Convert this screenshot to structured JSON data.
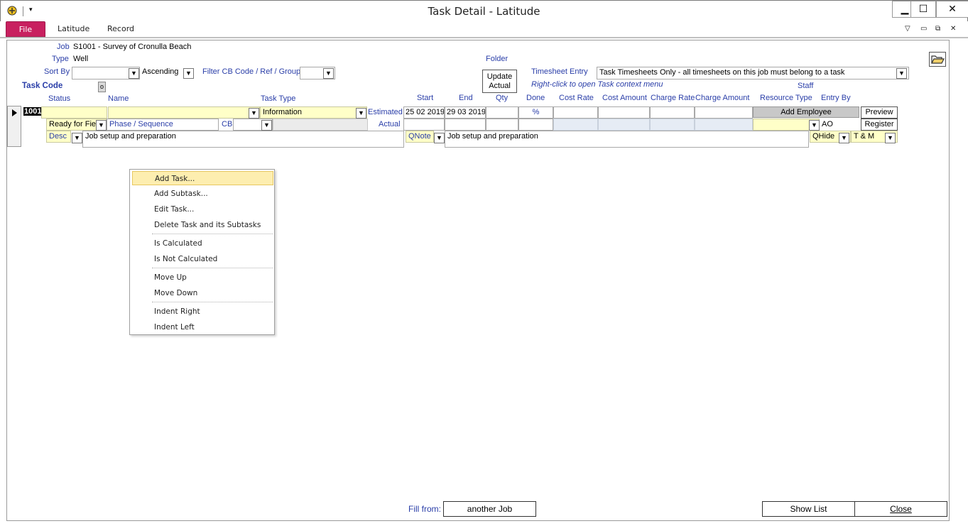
{
  "window": {
    "title": "Task Detail  -  Latitude",
    "minimize": "▁",
    "maximize": "☐",
    "close": "✕"
  },
  "ribbon": {
    "tabs": [
      "File",
      "Latitude",
      "Record"
    ],
    "right_icons": [
      "▽",
      "▭",
      "⧉",
      "✕"
    ]
  },
  "header": {
    "job_label": "Job",
    "job_value": "S1001 - Survey of Cronulla Beach",
    "type_label": "Type",
    "type_value": "Well",
    "folder_label": "Folder",
    "sort_by_label": "Sort By",
    "sort_by_value": "",
    "sort_order_value": "Ascending",
    "filter_label": "Filter CB Code / Ref / Group",
    "filter_value": "",
    "update_actual_line1": "Update",
    "update_actual_line2": "Actual",
    "timesheet_label": "Timesheet Entry",
    "timesheet_value": "Task Timesheets Only - all timesheets on this job must belong to a task",
    "hint": "Right-click to open Task context menu",
    "task_code_label": "Task Code",
    "task_code_btn": "o",
    "staff_label": "Staff"
  },
  "columns": {
    "status": "Status",
    "name": "Name",
    "task_type": "Task Type",
    "start": "Start",
    "end": "End",
    "qty": "Qty",
    "done": "Done",
    "cost_rate": "Cost Rate",
    "cost_amount": "Cost Amount",
    "charge_rate": "Charge Rate",
    "charge_amount": "Charge Amount",
    "resource_type": "Resource Type",
    "entry_by": "Entry By"
  },
  "task": {
    "code": "1001",
    "name": "",
    "task_type": "Information",
    "estimated_label": "Estimated",
    "start": "25 02 2019",
    "end": "29 03 2019",
    "done": "%",
    "add_employee": "Add Employee",
    "preview": "Preview",
    "status": "Ready for Fie",
    "phase_label": "Phase / Sequence",
    "cb_label": "CB",
    "actual_label": "Actual",
    "entry_by": "AO",
    "register": "Register",
    "desc_label": "Desc",
    "desc_value": "Job setup and preparation",
    "qnote_label": "QNote",
    "qnote_value": "Job setup and preparation",
    "qhide": "QHide",
    "billing": "T & M"
  },
  "context_menu": {
    "items": [
      "Add Task...",
      "Add Subtask...",
      "Edit Task...",
      "Delete Task and its Subtasks",
      "Is Calculated",
      "Is Not Calculated",
      "Move Up",
      "Move Down",
      "Indent Right",
      "Indent Left"
    ]
  },
  "footer": {
    "fill_from_label": "Fill from:",
    "another_job": "another Job",
    "show_list": "Show List",
    "close": "Close"
  }
}
